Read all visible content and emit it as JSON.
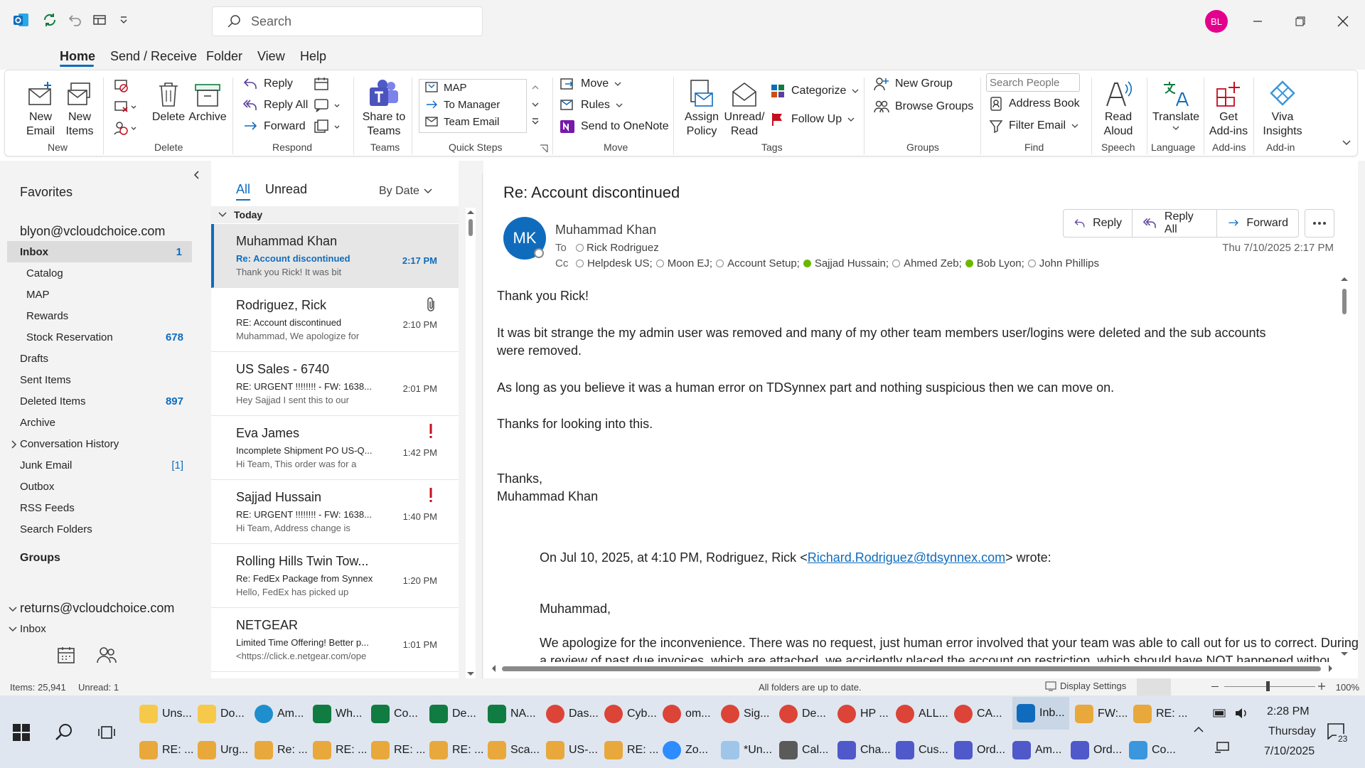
{
  "titlebar": {
    "search_placeholder": "Search",
    "avatar_initials": "BL"
  },
  "menu": {
    "tabs": [
      "Home",
      "Send / Receive",
      "Folder",
      "View",
      "Help"
    ]
  },
  "ribbon": {
    "new_email": "New\nEmail",
    "new_items": "New\nItems",
    "delete": "Delete",
    "archive": "Archive",
    "reply": "Reply",
    "reply_all": "Reply All",
    "forward": "Forward",
    "share_teams": "Share to\nTeams",
    "quick_steps": [
      "MAP",
      "To Manager",
      "Team Email"
    ],
    "move": "Move",
    "rules": "Rules",
    "onenote": "Send to OneNote",
    "assign_policy": "Assign\nPolicy",
    "unread_read": "Unread/\nRead",
    "categorize": "Categorize",
    "follow_up": "Follow Up",
    "new_group": "New Group",
    "browse_groups": "Browse Groups",
    "search_people_placeholder": "Search People",
    "address_book": "Address Book",
    "filter_email": "Filter Email",
    "read_aloud": "Read\nAloud",
    "translate": "Translate",
    "get_addins": "Get\nAdd-ins",
    "viva": "Viva\nInsights",
    "groups": {
      "new": "New",
      "delete": "Delete",
      "respond": "Respond",
      "teams": "Teams",
      "quick_steps": "Quick Steps",
      "move": "Move",
      "tags": "Tags",
      "groups": "Groups",
      "find": "Find",
      "speech": "Speech",
      "language": "Language",
      "addins": "Add-ins",
      "addin": "Add-in"
    }
  },
  "folders": {
    "favorites": "Favorites",
    "account": "blyon@vcloudchoice.com",
    "items": [
      {
        "label": "Inbox",
        "count": "1"
      },
      {
        "label": "Catalog"
      },
      {
        "label": "MAP"
      },
      {
        "label": "Rewards"
      },
      {
        "label": "Stock Reservation",
        "count": "678"
      },
      {
        "label": "Drafts"
      },
      {
        "label": "Sent Items"
      },
      {
        "label": "Deleted Items",
        "count": "897"
      },
      {
        "label": "Archive"
      },
      {
        "label": "Conversation History"
      },
      {
        "label": "Junk Email",
        "count": "[1]"
      },
      {
        "label": "Outbox"
      },
      {
        "label": "RSS Feeds"
      },
      {
        "label": "Search Folders"
      }
    ],
    "groups": "Groups",
    "account2": "returns@vcloudchoice.com",
    "inbox2": "Inbox"
  },
  "list": {
    "filter_all": "All",
    "filter_unread": "Unread",
    "sort": "By Date",
    "group_today": "Today",
    "messages": [
      {
        "sender": "Muhammad Khan",
        "subject": "Re: Account discontinued",
        "preview": "Thank you Rick!  It was bit",
        "time": "2:17 PM"
      },
      {
        "sender": "Rodriguez, Rick",
        "subject": "RE: Account discontinued",
        "preview": "Muhammad,   We apologize for",
        "time": "2:10 PM"
      },
      {
        "sender": "US Sales - 6740",
        "subject": "RE: URGENT !!!!!!!! - FW: 1638...",
        "preview": "Hey Sajjad  I sent this to our",
        "time": "2:01 PM"
      },
      {
        "sender": "Eva James",
        "subject": "Incomplete Shipment PO US-Q...",
        "preview": "Hi Team,   This order was for a",
        "time": "1:42 PM"
      },
      {
        "sender": "Sajjad Hussain",
        "subject": "RE: URGENT !!!!!!!! - FW: 1638...",
        "preview": "Hi Team,   Address change is",
        "time": "1:40 PM"
      },
      {
        "sender": "Rolling Hills Twin Tow...",
        "subject": "Re: FedEx Package from Synnex",
        "preview": "Hello,   FedEx has picked up",
        "time": "1:20 PM"
      },
      {
        "sender": "NETGEAR",
        "subject": "Limited Time Offering! Better p...",
        "preview": "<https://click.e.netgear.com/ope",
        "time": "1:01 PM"
      }
    ]
  },
  "reading": {
    "subject": "Re: Account discontinued",
    "avatar": "MK",
    "sender": "Muhammad Khan",
    "to_label": "To",
    "to": "Rick Rodriguez",
    "cc_label": "Cc",
    "cc": [
      "Helpdesk US;",
      "Moon EJ;",
      "Account Setup;",
      "Sajjad Hussain;",
      "Ahmed Zeb;",
      "Bob Lyon;",
      "John Phillips"
    ],
    "date": "Thu 7/10/2025 2:17 PM",
    "reply": "Reply",
    "reply_all": "Reply All",
    "forward": "Forward",
    "p1": "Thank you Rick!",
    "p2a": "It was bit strange the my admin user was removed and many of my other team members user/logins were deleted and the sub accounts",
    "p2b": "were removed.",
    "p3": "As long as you believe it was a human error on TDSynnex part and nothing suspicious then we can move on.",
    "p4": "Thanks for looking into this.",
    "sig1": "Thanks,",
    "sig2": "Muhammad Khan",
    "quote_pre": "On Jul 10, 2025, at 4:10 PM, Rodriguez, Rick <",
    "quote_email": "Richard.Rodriguez@tdsynnex.com",
    "quote_post": "> wrote:",
    "q1": "Muhammad,",
    "q2a": "We apologize for the inconvenience. There was no request, just human error involved that your team was able to call out for us to correct. During",
    "q2b": "a review of past due invoices, which are attached, we accidently placed the account on restriction, which should have NOT happened without"
  },
  "status": {
    "items": "Items: 25,941",
    "unread": "Unread: 1",
    "sync": "All folders are up to date.",
    "display": "Display Settings",
    "zoom": "100%"
  },
  "taskbar": {
    "row1": [
      "Uns...",
      "Do...",
      "Am...",
      "Wh...",
      "Co...",
      "De...",
      "NA...",
      "Das...",
      "Cyb...",
      "om...",
      "Sig...",
      "De...",
      "HP ...",
      "ALL...",
      "CA...",
      "Inb...",
      "FW:...",
      "RE: ..."
    ],
    "row2": [
      "RE: ...",
      "Urg...",
      "Re: ...",
      "RE: ...",
      "RE: ...",
      "RE: ...",
      "Sca...",
      "US-...",
      "RE: ...",
      "Zo...",
      "*Un...",
      "Cal...",
      "Cha...",
      "Cus...",
      "Ord...",
      "Am...",
      "Ord...",
      "Co..."
    ],
    "time": "2:28 PM",
    "day": "Thursday",
    "date": "7/10/2025",
    "notif": "23"
  },
  "colors": {
    "accent": "#0f6cbd",
    "flag": "#c50f1f",
    "avatar_top": "#e3008c"
  }
}
